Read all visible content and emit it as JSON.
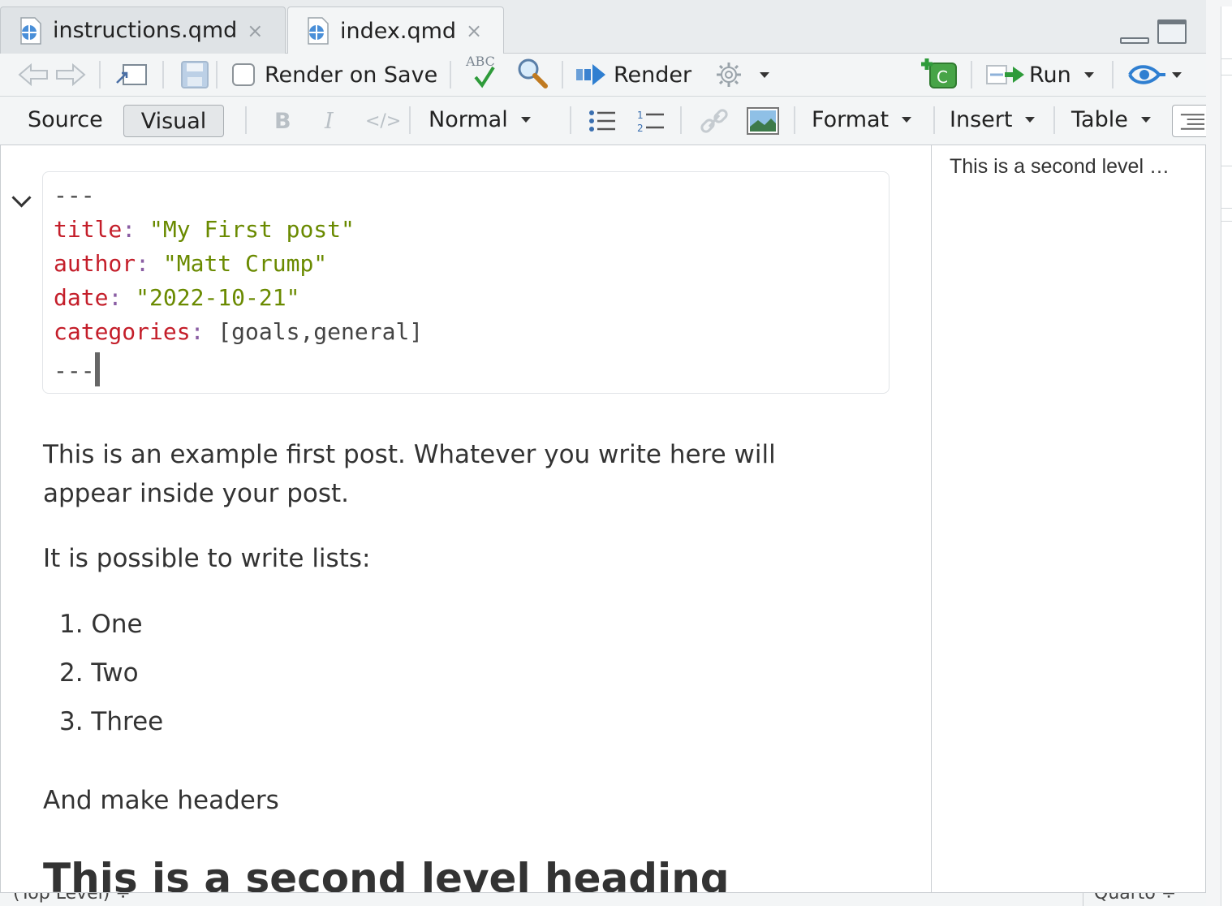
{
  "tabs": [
    {
      "label": "instructions.qmd",
      "active": false,
      "close": "×"
    },
    {
      "label": "index.qmd",
      "active": true,
      "close": "×"
    }
  ],
  "toolbar": {
    "render_on_save_label": "Render on Save",
    "render_on_save_checked": false,
    "spell_label": "ABC",
    "render_label": "Render",
    "run_label": "Run"
  },
  "format_bar": {
    "source_label": "Source",
    "visual_label": "Visual",
    "bold_label": "B",
    "italic_label": "I",
    "code_label": "</>",
    "style_label": "Normal",
    "format_label": "Format",
    "insert_label": "Insert",
    "table_label": "Table"
  },
  "yaml": {
    "open_dashes": "---",
    "fields": [
      {
        "key": "title",
        "value": "\"My First post\""
      },
      {
        "key": "author",
        "value": "\"Matt Crump\""
      },
      {
        "key": "date",
        "value": "\"2022-10-21\""
      },
      {
        "key": "categories",
        "value": "[goals,general]"
      }
    ],
    "close_dashes": "---"
  },
  "content": {
    "para1_line1": "This is an example first post. Whatever you write here will",
    "para1_line2": "appear inside your post.",
    "para2": "It is possible to write lists:",
    "list": [
      "1. One",
      "2. Two",
      "3. Three"
    ],
    "para3": "And make headers",
    "heading": "This is a second level heading"
  },
  "outline": {
    "item": "This is a second level …"
  },
  "status": {
    "left": "(Top Level) ÷",
    "right": "Quarto ÷"
  },
  "colors": {
    "yaml_key": "#c41e2a",
    "yaml_string": "#6a8a00",
    "yaml_punct": "#8a5da3",
    "accent_blue": "#2f7fd1",
    "accent_green": "#2e9b3a"
  }
}
